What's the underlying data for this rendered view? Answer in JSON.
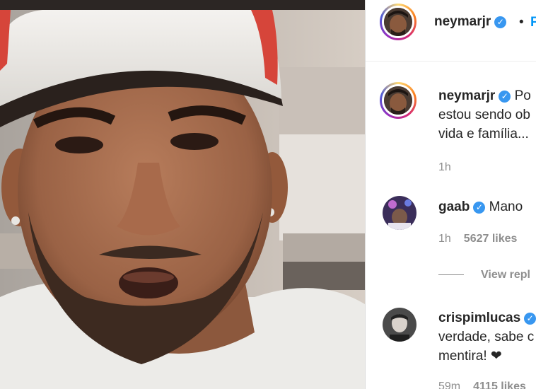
{
  "post": {
    "author": "neymarjr",
    "separator": "•",
    "follow_label": "F"
  },
  "caption": {
    "username": "neymarjr",
    "lines": [
      "Po",
      "estou sendo ob",
      "vida e família..."
    ],
    "time": "1h"
  },
  "comments": [
    {
      "username": "gaab",
      "text": "Mano",
      "time": "1h",
      "likes": "5627 likes",
      "view_replies": "View repl"
    },
    {
      "username": "crispimlucas",
      "lines": [
        "verdade, sabe c",
        "mentira! ❤"
      ],
      "time": "59m",
      "likes": "4115 likes"
    }
  ],
  "colors": {
    "follow": "#0095f6",
    "verified": "#3897f0",
    "muted": "#8e8e8e"
  },
  "icons": [
    "verified-badge-icon",
    "heart-icon"
  ]
}
